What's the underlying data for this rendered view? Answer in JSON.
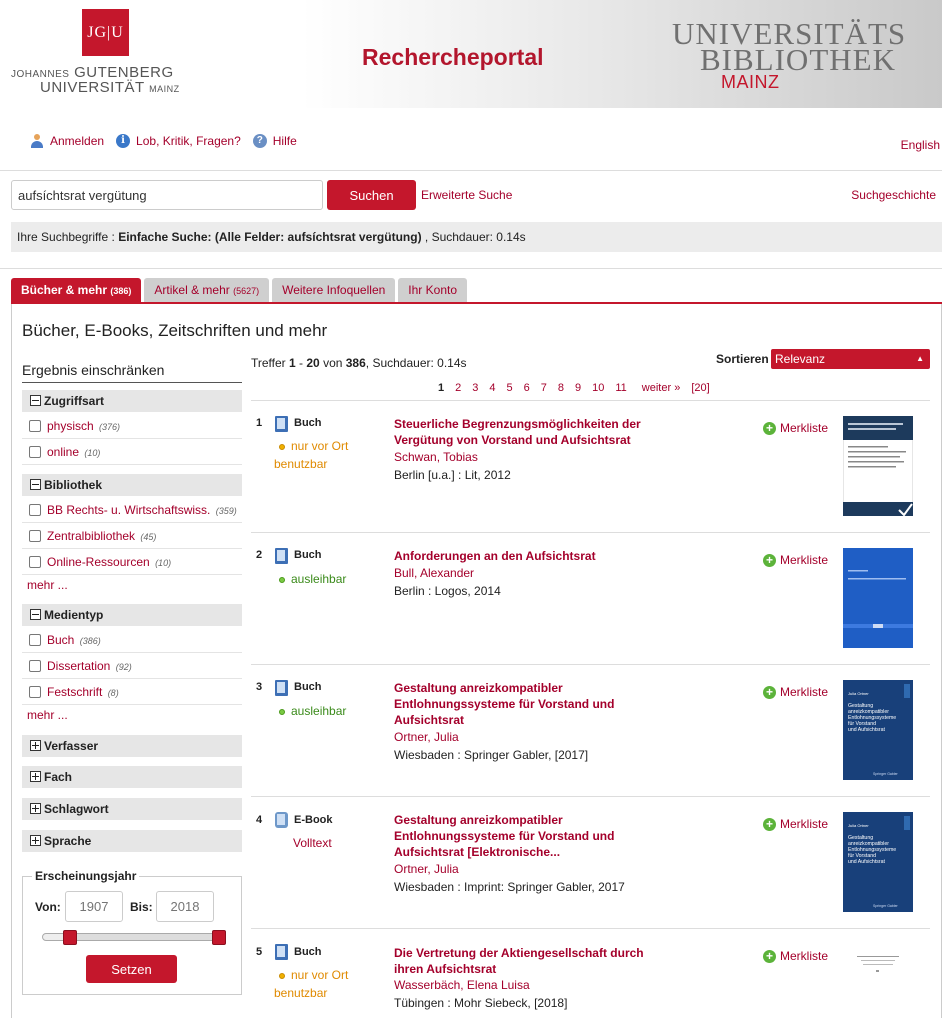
{
  "header": {
    "jgu_logo": "JG|U",
    "jgu_line1_a": "JOHANNES",
    "jgu_line1_b": "GUTENBERG",
    "jgu_line2_a": "UNIVERSITÄT",
    "jgu_line2_b": "MAINZ",
    "portal_title": "Rechercheportal",
    "ub_line1": "UNIVERSITÄTS",
    "ub_line2": "BIBLIOTHEK",
    "ub_mainz": "MAINZ"
  },
  "toplinks": {
    "login": "Anmelden",
    "feedback": "Lob, Kritik, Fragen?",
    "help": "Hilfe",
    "language": "English"
  },
  "search": {
    "query": "aufsíchtsrat vergütung",
    "button": "Suchen",
    "advanced": "Erweiterte Suche",
    "history": "Suchgeschichte",
    "summary_prefix": "Ihre Suchbegriffe : ",
    "summary_terms": "Einfache Suche: (Alle Felder: aufsíchtsrat vergütung)",
    "summary_suffix": " , Suchdauer: 0.14s"
  },
  "tabs": [
    {
      "label": "Bücher & mehr",
      "count": "(386)"
    },
    {
      "label": "Artikel & mehr",
      "count": "(5627)"
    },
    {
      "label": "Weitere Infoquellen",
      "count": ""
    },
    {
      "label": "Ihr Konto",
      "count": ""
    }
  ],
  "panel_title": "Bücher, E-Books, Zeitschriften und mehr",
  "facets": {
    "heading": "Ergebnis einschränken",
    "groups": {
      "zugriff": "Zugriffsart",
      "bibliothek": "Bibliothek",
      "medientyp": "Medientyp",
      "verfasser": "Verfasser",
      "fach": "Fach",
      "schlagwort": "Schlagwort",
      "sprache": "Sprache"
    },
    "zugriff_items": [
      {
        "label": "physisch",
        "count": "(376)"
      },
      {
        "label": "online",
        "count": "(10)"
      }
    ],
    "bibliothek_items": [
      {
        "label": "BB Rechts- u. Wirtschaftswiss.",
        "count": "(359)"
      },
      {
        "label": "Zentralbibliothek",
        "count": "(45)"
      },
      {
        "label": "Online-Ressourcen",
        "count": "(10)"
      }
    ],
    "medientyp_items": [
      {
        "label": "Buch",
        "count": "(386)"
      },
      {
        "label": "Dissertation",
        "count": "(92)"
      },
      {
        "label": "Festschrift",
        "count": "(8)"
      }
    ],
    "more": "mehr ...",
    "year": {
      "legend": "Erscheinungsjahr",
      "from_label": "Von:",
      "from_placeholder": "1907",
      "to_label": "Bis:",
      "to_placeholder": "2018",
      "button": "Setzen"
    }
  },
  "results_meta": {
    "hits_prefix": "Treffer ",
    "hits_range_a": "1",
    "hits_range_sep": " - ",
    "hits_range_b": "20",
    "hits_von": " von ",
    "hits_total": "386",
    "hits_suffix": ", Suchdauer: 0.14s",
    "sort_label": "Sortieren",
    "sort_value": "Relevanz",
    "pages": [
      "1",
      "2",
      "3",
      "4",
      "5",
      "6",
      "7",
      "8",
      "9",
      "10",
      "11"
    ],
    "next": "weiter »",
    "last": "[20]"
  },
  "results": [
    {
      "num": "1",
      "type": "Buch",
      "avail": "nur vor Ort",
      "avail2": "benutzbar",
      "title": "Steuerliche Begrenzungsmöglichkeiten der Vergütung von Vorstand und Aufsichtsrat",
      "author": "Schwan, Tobias",
      "pub": "Berlin [u.a.] : Lit, 2012",
      "merk": "Merkliste"
    },
    {
      "num": "2",
      "type": "Buch",
      "avail": "ausleihbar",
      "avail2": "",
      "title": "Anforderungen an den Aufsichtsrat",
      "author": "Bull, Alexander",
      "pub": "Berlin : Logos, 2014",
      "merk": "Merkliste"
    },
    {
      "num": "3",
      "type": "Buch",
      "avail": "ausleihbar",
      "avail2": "",
      "title": "Gestaltung anreizkompatibler Entlohnungssysteme für Vorstand und Aufsichtsrat",
      "author": "Ortner, Julia",
      "pub": "Wiesbaden : Springer Gabler, [2017]",
      "merk": "Merkliste"
    },
    {
      "num": "4",
      "type": "E-Book",
      "avail": "Volltext",
      "avail2": "",
      "title": "Gestaltung anreizkompatibler Entlohnungssysteme für Vorstand und Aufsichtsrat [Elektronische...",
      "author": "Ortner, Julia",
      "pub": "Wiesbaden : Imprint: Springer Gabler, 2017",
      "merk": "Merkliste"
    },
    {
      "num": "5",
      "type": "Buch",
      "avail": "nur vor Ort",
      "avail2": "benutzbar",
      "title": "Die Vertretung der Aktiengesellschaft durch ihren Aufsichtsrat",
      "author": "Wasserbäch, Elena Luisa",
      "pub": "Tübingen : Mohr Siebeck, [2018]",
      "merk": "Merkliste"
    }
  ],
  "covers": {
    "c1_text": "Steuerliche Begrenzungsmöglichkeiten der Vergütung von Vorstand und Aufsichtsrat",
    "c3_author": "Julia Ortner",
    "c3_text": "Gestaltung anreizkompatibler Entlohnungssysteme für Vorstand und Aufsichtsrat",
    "c3_brand": "Springer Gabler"
  },
  "colors": {
    "brand_red": "#c4172c",
    "link_red": "#a4002b",
    "available_green": "#3a8a1a",
    "onsite_orange": "#e08a00"
  }
}
